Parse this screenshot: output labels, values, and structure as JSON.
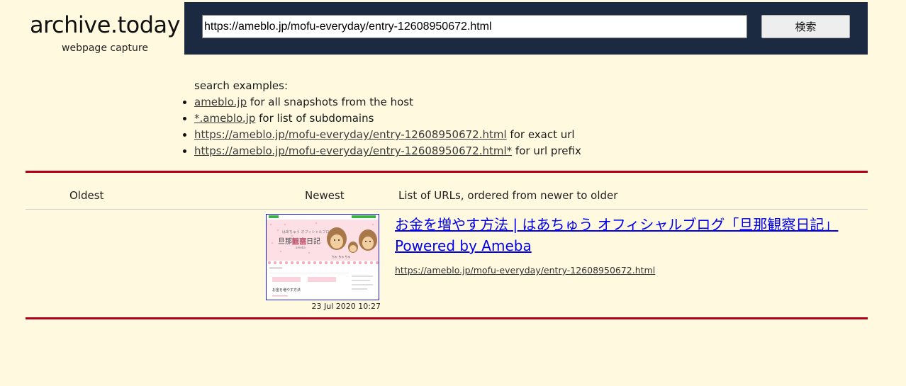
{
  "logo": {
    "title": "archive.today",
    "subtitle": "webpage capture"
  },
  "search": {
    "value": "https://ameblo.jp/mofu-everyday/entry-12608950672.html",
    "button_label": "検索"
  },
  "examples": {
    "heading": "search examples:",
    "items": [
      {
        "link": "ameblo.jp",
        "text": " for all snapshots from the host"
      },
      {
        "link": "*.ameblo.jp",
        "text": " for list of subdomains"
      },
      {
        "link": "https://ameblo.jp/mofu-everyday/entry-12608950672.html",
        "text": " for exact url"
      },
      {
        "link": "https://ameblo.jp/mofu-everyday/entry-12608950672.html*",
        "text": " for url prefix"
      }
    ]
  },
  "table": {
    "headers": {
      "oldest": "Oldest",
      "newest": "Newest",
      "list": "List of URLs, ordered from newer to older"
    }
  },
  "result": {
    "title": "お金を増やす方法 | はあちゅう オフィシャルブログ「旦那観察日記」 Powered by Ameba",
    "url": "https://ameblo.jp/mofu-everyday/entry-12608950672.html",
    "date": "23 Jul 2020 10:27",
    "thumbnail": {
      "blog_title": "旦那観察日記",
      "post_title": "お金を増やす方法"
    }
  },
  "colors": {
    "background": "#fffadf",
    "bar": "#1b2a40",
    "rule": "#b00018",
    "link": "#0000ee"
  }
}
